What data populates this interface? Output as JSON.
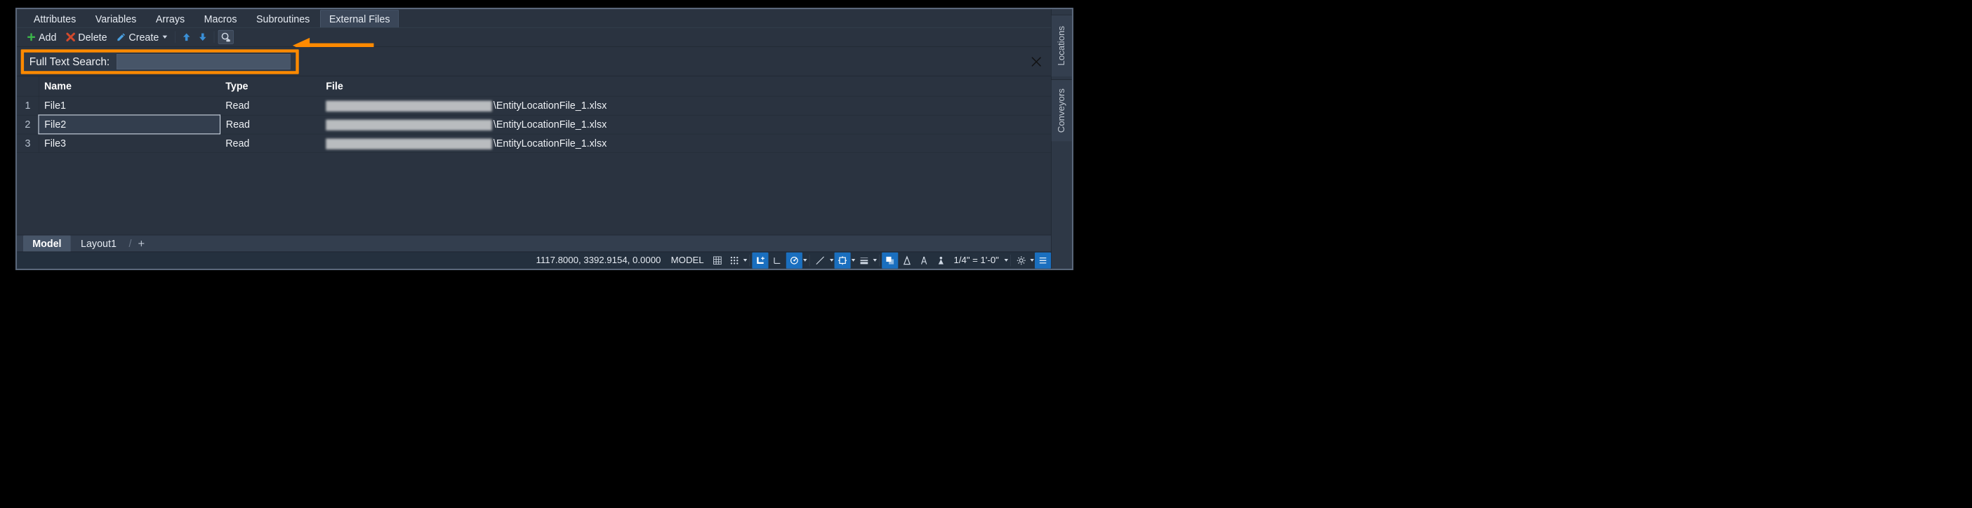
{
  "tabs": {
    "items": [
      {
        "label": "Attributes"
      },
      {
        "label": "Variables"
      },
      {
        "label": "Arrays"
      },
      {
        "label": "Macros"
      },
      {
        "label": "Subroutines"
      },
      {
        "label": "External Files"
      }
    ],
    "active_index": 5
  },
  "toolbar": {
    "add": "Add",
    "delete": "Delete",
    "create": "Create"
  },
  "search": {
    "label": "Full Text Search:",
    "value": ""
  },
  "table": {
    "headers": {
      "name": "Name",
      "type": "Type",
      "file": "File"
    },
    "rows": [
      {
        "n": "1",
        "name": "File1",
        "type": "Read",
        "file_suffix": "\\EntityLocationFile_1.xlsx"
      },
      {
        "n": "2",
        "name": "File2",
        "type": "Read",
        "file_suffix": "\\EntityLocationFile_1.xlsx"
      },
      {
        "n": "3",
        "name": "File3",
        "type": "Read",
        "file_suffix": "\\EntityLocationFile_1.xlsx"
      }
    ],
    "selected_row": 1
  },
  "sheets": {
    "items": [
      {
        "label": "Model"
      },
      {
        "label": "Layout1"
      }
    ],
    "active_index": 0
  },
  "status": {
    "coords": "1117.8000, 3392.9154, 0.0000",
    "space": "MODEL",
    "zoom": "1/4\" = 1'-0\""
  },
  "side_tabs": {
    "items": [
      {
        "label": "Locations"
      },
      {
        "label": "Conveyors"
      }
    ]
  },
  "colors": {
    "accent_orange": "#ff8a00",
    "add_green": "#3cb64a",
    "delete_red": "#d2492c",
    "create_blue": "#4a9fe0",
    "arrow_blue": "#3a8fd6"
  }
}
